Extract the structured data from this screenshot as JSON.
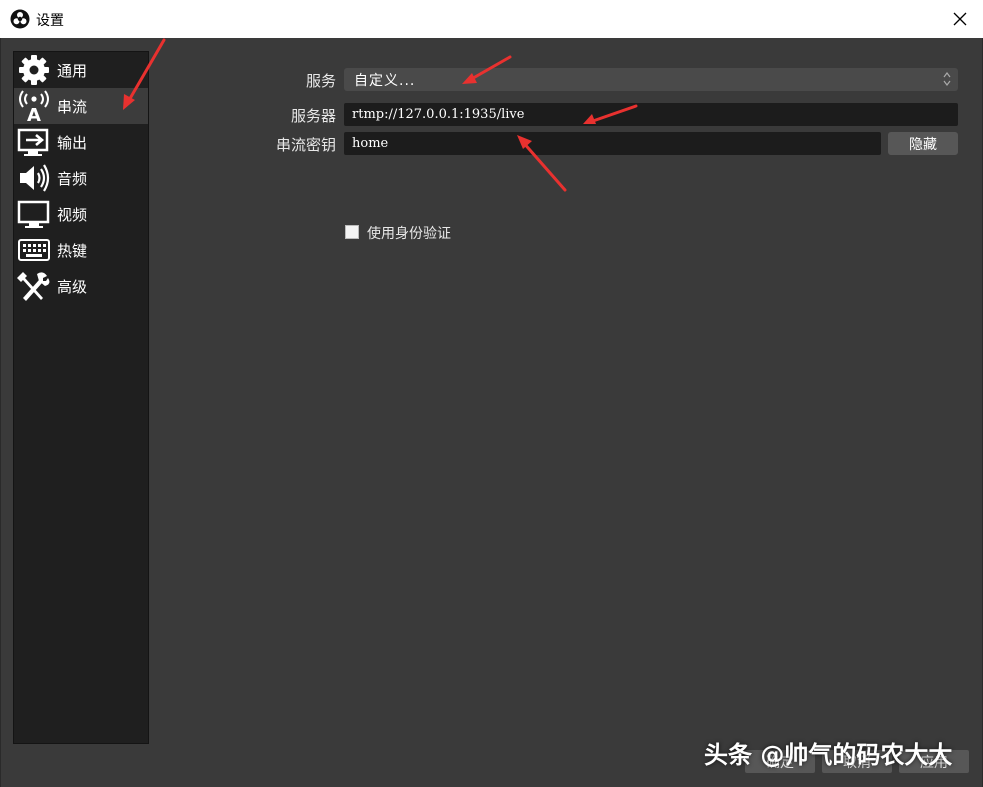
{
  "window": {
    "title": "设置"
  },
  "sidebar": {
    "items": [
      {
        "label": "通用",
        "icon": "gear-icon"
      },
      {
        "label": "串流",
        "icon": "antenna-icon"
      },
      {
        "label": "输出",
        "icon": "output-icon"
      },
      {
        "label": "音频",
        "icon": "speaker-icon"
      },
      {
        "label": "视频",
        "icon": "monitor-icon"
      },
      {
        "label": "热键",
        "icon": "keyboard-icon"
      },
      {
        "label": "高级",
        "icon": "tools-icon"
      }
    ],
    "active_index": 1
  },
  "stream": {
    "service_label": "服务",
    "service_value": "自定义...",
    "server_label": "服务器",
    "server_value": "rtmp://127.0.0.1:1935/live",
    "key_label": "串流密钥",
    "key_value": "home",
    "hide_button": "隐藏",
    "auth_label": "使用身份验证",
    "auth_checked": false
  },
  "footer": {
    "ok_label": "确定",
    "cancel_label": "取消",
    "apply_label": "应用"
  },
  "watermark": "头条 @帅气的码农大大",
  "colors": {
    "background": "#3a3a3a",
    "sidebar": "#1f1f1f",
    "active_item": "#3c3c3c",
    "annotation_arrow": "#e8312f"
  }
}
